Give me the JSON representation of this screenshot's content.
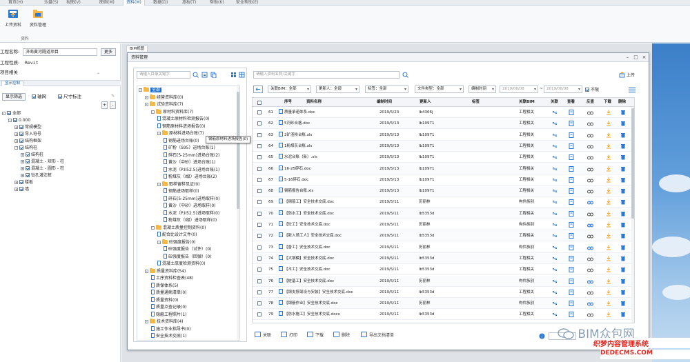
{
  "ribbon": {
    "tabs": [
      "首页(H)",
      "沙盘(S)",
      "视图(V)",
      "图例(M)",
      "资料(M)",
      "数据(D)",
      "旅程(T)",
      "帮助(K)",
      "安全帮助(E)"
    ],
    "active_tab_index": 4,
    "buttons": [
      {
        "label": "上传资料",
        "icon": "upload-icon"
      },
      {
        "label": "资料管理",
        "icon": "folder-manage-icon"
      }
    ],
    "group_label": "资料"
  },
  "left": {
    "project_label": "工程名称:",
    "project_value": "济南黄河隧道项目",
    "more_btn": "更多",
    "nature_label": "工程性质:",
    "nature_value": "Revit",
    "related_label": "项目相关",
    "panel_tab": "显示控制",
    "show_filter_btn": "显示筛选",
    "axis_label": "轴网",
    "dim_label": "尺寸标注",
    "tree": [
      {
        "label": "全部",
        "level": 0,
        "exp": "-"
      },
      {
        "label": "0.000",
        "level": 1,
        "exp": "-"
      },
      {
        "label": "常规模型",
        "level": 2,
        "exp": "+"
      },
      {
        "label": "导入符号",
        "level": 2,
        "exp": "+"
      },
      {
        "label": "结构框架",
        "level": 2,
        "exp": "+"
      },
      {
        "label": "结构柱",
        "level": 2,
        "exp": "-"
      },
      {
        "label": "结构柱",
        "level": 3,
        "exp": "+"
      },
      {
        "label": "混凝土 - 矩形 - 柱",
        "level": 3,
        "exp": "+"
      },
      {
        "label": "混凝土 - 圆形 - 柱",
        "level": 3,
        "exp": "+"
      },
      {
        "label": "钻孔灌注桩",
        "level": 3,
        "exp": "+"
      },
      {
        "label": "楼板",
        "level": 2,
        "exp": "+"
      },
      {
        "label": "墙",
        "level": 2,
        "exp": "+"
      }
    ]
  },
  "bim_tab": "BIM视图",
  "dialog": {
    "title": "资料管理",
    "tree_search_placeholder": "请输入目录关键字",
    "tooltip": "钢筋原材料进场报告(0)",
    "tree": [
      {
        "label": "全部",
        "level": 0,
        "sel": true
      },
      {
        "label": "经营资料库(0)",
        "level": 1
      },
      {
        "label": "试验资料库(7)",
        "level": 1
      },
      {
        "label": "原材料资料库(7)",
        "level": 2
      },
      {
        "label": "混凝土原材料检测报告(0)",
        "level": 3,
        "file": true
      },
      {
        "label": "钢筋原材料进场报告(0)",
        "level": 3,
        "file": true
      },
      {
        "label": "原材料进场台账(7)",
        "level": 3
      },
      {
        "label": "钢筋进场台账(0)",
        "level": 4,
        "file": true
      },
      {
        "label": "矿粉（S95）进场台账(1)",
        "level": 4,
        "file": true
      },
      {
        "label": "碎石(5-25mm)进场台账(2)",
        "level": 4,
        "file": true
      },
      {
        "label": "黄沙（中砂）进场台账(1)",
        "level": 4,
        "file": true
      },
      {
        "label": "水泥（P.II52.5)进场台账(1)",
        "level": 4,
        "file": true
      },
      {
        "label": "粉煤灰（I级）进场台账(2)",
        "level": 4,
        "file": true
      },
      {
        "label": "取样留样见证(0)",
        "level": 3
      },
      {
        "label": "钢筋进场取样(0)",
        "level": 4,
        "file": true
      },
      {
        "label": "碎石(5-25mm)进场取样(0)",
        "level": 4,
        "file": true
      },
      {
        "label": "黄沙（中砂）进场取样(0)",
        "level": 4,
        "file": true
      },
      {
        "label": "水泥（P.II52.5)进场取样(0)",
        "level": 4,
        "file": true
      },
      {
        "label": "粉煤灰（I级）进场取样(0)",
        "level": 4,
        "file": true
      },
      {
        "label": "混凝土质量控制资料(0)",
        "level": 2
      },
      {
        "label": "配合比设计文件(0)",
        "level": 3,
        "file": true
      },
      {
        "label": "砼强度报告(0)",
        "level": 3
      },
      {
        "label": "砼强度报告（试件）(0)",
        "level": 4,
        "file": true
      },
      {
        "label": "砼强度报告（回弹）(0)",
        "level": 4,
        "file": true
      },
      {
        "label": "混凝土厚度检测资料(0)",
        "level": 3,
        "file": true
      },
      {
        "label": "质量资料库(54)",
        "level": 1
      },
      {
        "label": "工序资料检查表(48)",
        "level": 2,
        "file": true
      },
      {
        "label": "质保体系(5)",
        "level": 2,
        "file": true
      },
      {
        "label": "质量通病清单(0)",
        "level": 2,
        "file": true
      },
      {
        "label": "质量资料(0)",
        "level": 2,
        "file": true
      },
      {
        "label": "质量点查记录(0)",
        "level": 2,
        "file": true
      },
      {
        "label": "隐蔽工程照片(1)",
        "level": 2,
        "file": true
      },
      {
        "label": "技术资料库(4)",
        "level": 1
      },
      {
        "label": "施工作业指导书(0)",
        "level": 2,
        "file": true
      },
      {
        "label": "安全技术交底(1)",
        "level": 2,
        "file": true
      }
    ],
    "file_search_placeholder": "请输入资料名称/关键字",
    "upload_label": "上传",
    "filters": {
      "bim": "关联BIM：全部",
      "updater": "更新人：全部",
      "tag": "标签：全部",
      "filetype": "文件类型：全部",
      "time_label": "编制时间",
      "date_from": "2019/06/08",
      "date_to": "2019/06/08",
      "range_sep": "~",
      "nolimit": "不限"
    },
    "columns": [
      "序号",
      "资料名称",
      "编制时间",
      "更新人",
      "标签",
      "关联BIM",
      "关联",
      "查看",
      "反查",
      "下载",
      "删除"
    ],
    "rows": [
      {
        "no": "61",
        "name": "质量承诺体系.doc",
        "date": "2019/5/23",
        "user": "lb4366j",
        "bim": "工程相关"
      },
      {
        "no": "62",
        "name": "5河砂合格.doc",
        "date": "2019/5/13",
        "user": "lb10971",
        "bim": "工程相关"
      },
      {
        "no": "63",
        "name": "2矿渣粉台账.xls",
        "date": "2019/5/13",
        "user": "lb10971",
        "bim": "工程相关"
      },
      {
        "no": "64",
        "name": "1粉煤灰台账.xls",
        "date": "2019/5/13",
        "user": "lb10971",
        "bim": "工程相关"
      },
      {
        "no": "65",
        "name": "水泥台账（新）.xls",
        "date": "2019/5/13",
        "user": "lb10971",
        "bim": "工程相关"
      },
      {
        "no": "66",
        "name": "16-25碎石.doc",
        "date": "2019/5/13",
        "user": "lb10971",
        "bim": "工程相关"
      },
      {
        "no": "67",
        "name": "5-16碎石.doc",
        "date": "2019/5/13",
        "user": "lb10971",
        "bim": "工程相关"
      },
      {
        "no": "68",
        "name": "钢筋报告台账.xls",
        "date": "2019/5/13",
        "user": "lb10971",
        "bim": "工程相关"
      },
      {
        "no": "69",
        "name": "【钢筋工】安全技术交底.doc",
        "date": "2019/5/11",
        "user": "历丽林",
        "bim": "构件族别"
      },
      {
        "no": "70",
        "name": "【防水工】安全技术交底.doc",
        "date": "2019/5/11",
        "user": "lb5353d",
        "bim": "工程相关"
      },
      {
        "no": "71",
        "name": "【砼工】安全技术交底.doc",
        "date": "2019/5/11",
        "user": "历丽林",
        "bim": "构件族别"
      },
      {
        "no": "72",
        "name": "【新入场工人】安全技术交底.doc",
        "date": "2019/5/11",
        "user": "lb5353d",
        "bim": "工程相关"
      },
      {
        "no": "73",
        "name": "【普工】安全技术交底.doc",
        "date": "2019/5/11",
        "user": "历丽林",
        "bim": "构件族别"
      },
      {
        "no": "74",
        "name": "【大钢模】安全技术交底.doc",
        "date": "2019/5/11",
        "user": "lb5353d",
        "bim": "工程相关"
      },
      {
        "no": "75",
        "name": "【木工】安全技术交底.doc",
        "date": "2019/5/11",
        "user": "lb5353d",
        "bim": "工程相关"
      },
      {
        "no": "76",
        "name": "【桩基工】安全技术交底.doc",
        "date": "2019/5/11",
        "user": "历丽林",
        "bim": "构件族别"
      },
      {
        "no": "77",
        "name": "【钢支撑架设与安装】安全技术交底.doc",
        "date": "2019/5/11",
        "user": "lb5353d",
        "bim": "工程相关"
      },
      {
        "no": "78",
        "name": "【钢筋作业】安全技术交底.doc",
        "date": "2019/5/11",
        "user": "历丽林",
        "bim": "构件族别"
      },
      {
        "no": "79",
        "name": "【防水施工】安全技术交底.docx",
        "date": "2019/5/11",
        "user": "lb5353d",
        "bim": "工程相关"
      }
    ],
    "bottom": [
      "关联",
      "打印",
      "下载",
      "删除",
      "导出文档清单"
    ]
  },
  "watermark": {
    "logo": "BIM众包网",
    "line1": "织梦内容管理系统",
    "line2": "DEDECMS.COM"
  },
  "colors": {
    "accent": "#1b6fd1",
    "folder": "#f2b84b",
    "link": "#2f78cf"
  }
}
